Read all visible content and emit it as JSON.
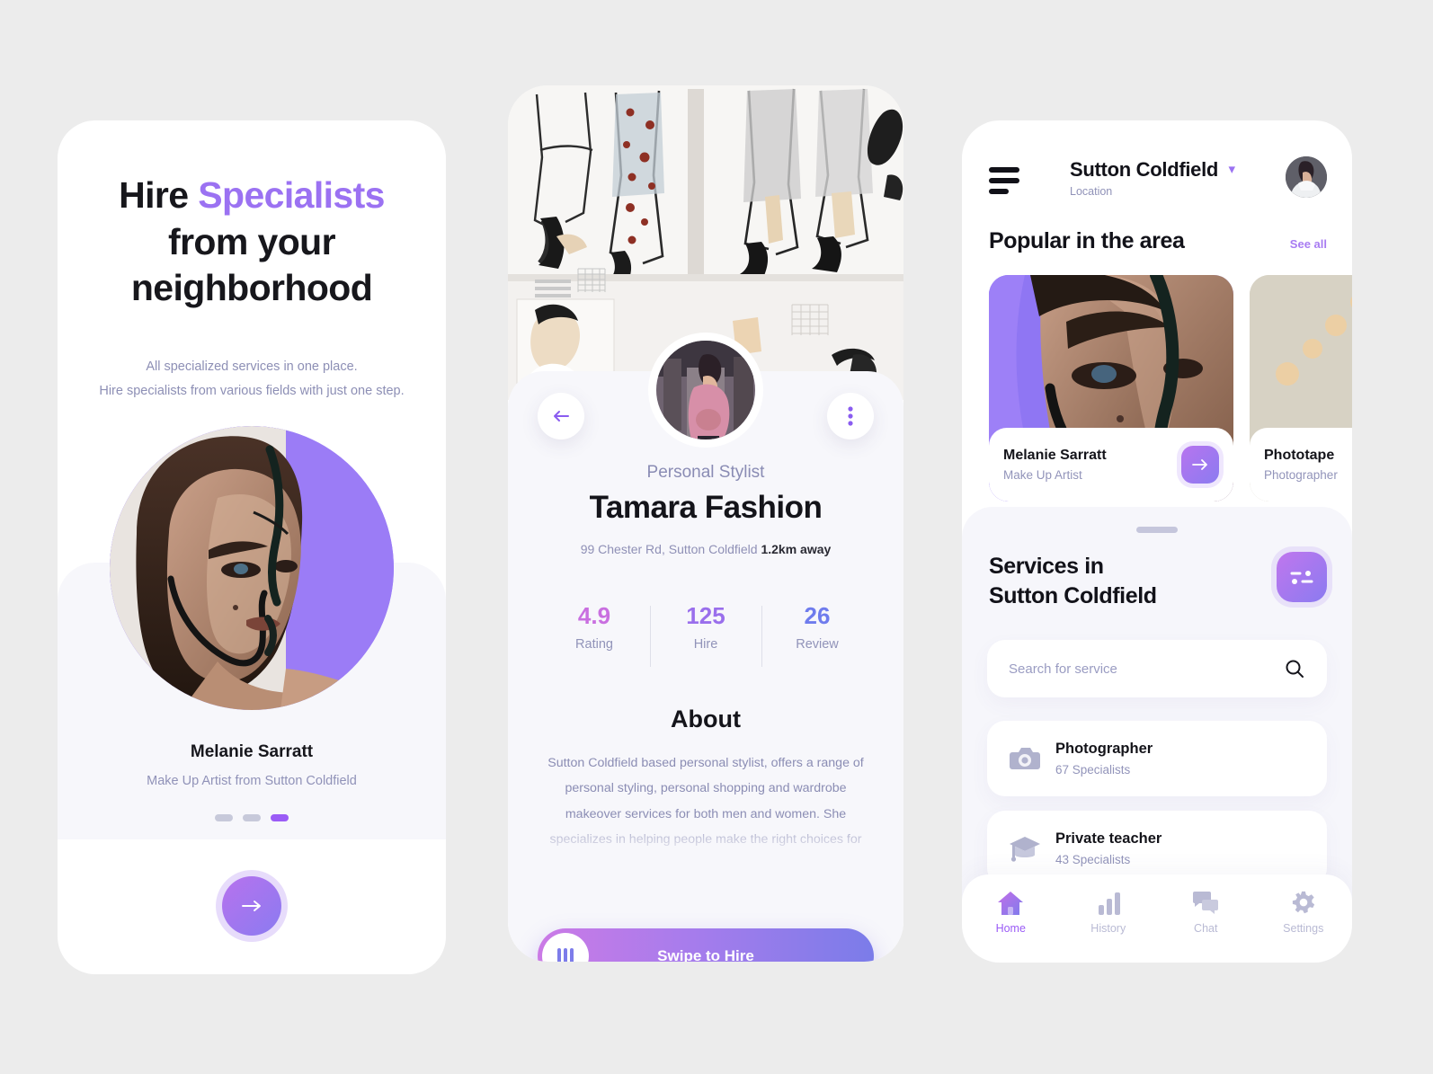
{
  "onboarding": {
    "title_line1_plain": "Hire ",
    "title_line1_accent": "Specialists",
    "title_line2": "from your",
    "title_line3": "neighborhood",
    "subtitle_line1": "All specialized services in one place.",
    "subtitle_line2": "Hire specialists from various fields with just one step.",
    "profile_name": "Melanie Sarratt",
    "profile_role": "Make Up Artist from Sutton Coldfield",
    "pagination": {
      "total": 3,
      "active_index": 2
    },
    "next_icon": "arrow-right-icon"
  },
  "profile": {
    "back_icon": "arrow-left-icon",
    "more_icon": "more-vertical-icon",
    "role": "Personal Stylist",
    "name": "Tamara Fashion",
    "address": "99 Chester Rd, Sutton Coldfield ",
    "distance": "1.2km away",
    "stats": [
      {
        "value": "4.9",
        "label": "Rating",
        "color": "#c96fe0"
      },
      {
        "value": "125",
        "label": "Hire",
        "color": "#9a6fec"
      },
      {
        "value": "26",
        "label": "Review",
        "color": "#6f7ced"
      }
    ],
    "about_heading": "About",
    "about_text": "Sutton Coldfield based personal stylist, offers a range of personal styling, personal shopping and wardrobe makeover services for both men and women. She specializes in helping people make the right choices for their body shape, lifestyle, and personality. The services",
    "swipe_label": "Swipe to Hire",
    "swipe_handle_icon": "drag-handle-icon"
  },
  "home": {
    "menu_icon": "hamburger-icon",
    "location_value": "Sutton Coldfield",
    "location_caption": "Location",
    "location_chevron_icon": "chevron-down-icon",
    "avatar_icon": "user-avatar",
    "popular": {
      "title": "Popular in the area",
      "see_all": "See all",
      "cards": [
        {
          "name": "Melanie Sarratt",
          "role": "Make Up Artist",
          "action_icon": "arrow-right-icon"
        },
        {
          "name": "Phototape",
          "role": "Photographer",
          "action_icon": "arrow-right-icon"
        }
      ]
    },
    "services": {
      "title_line1": "Services in",
      "title_line2": "Sutton Coldfield",
      "filter_icon": "filter-sliders-icon",
      "search_placeholder": "Search for service",
      "search_value": "",
      "search_icon": "search-icon",
      "items": [
        {
          "name": "Photographer",
          "count": "67 Specialists",
          "icon": "camera-icon"
        },
        {
          "name": "Private teacher",
          "count": "43 Specialists",
          "icon": "graduation-cap-icon"
        }
      ]
    },
    "bottom_nav": [
      {
        "label": "Home",
        "icon": "home-icon",
        "active": true
      },
      {
        "label": "History",
        "icon": "bar-chart-icon",
        "active": false
      },
      {
        "label": "Chat",
        "icon": "chat-bubbles-icon",
        "active": false
      },
      {
        "label": "Settings",
        "icon": "gear-icon",
        "active": false
      }
    ]
  },
  "theme": {
    "accent_purple": "#9b5cf6",
    "accent_pink": "#c77ce0",
    "accent_blue": "#7b7ce8",
    "muted_text": "#9092b8",
    "page_background": "#ececec"
  }
}
